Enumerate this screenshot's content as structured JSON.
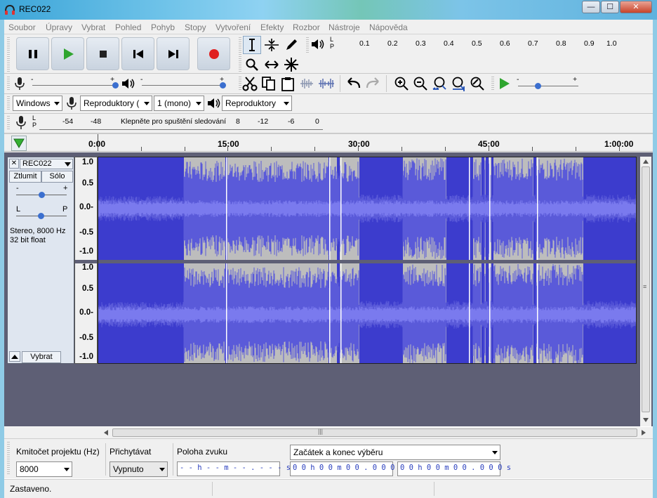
{
  "window": {
    "title": "REC022",
    "min": "—",
    "max": "☐",
    "close": "✕"
  },
  "menu": [
    "Soubor",
    "Úpravy",
    "Vybrat",
    "Pohled",
    "Pohyb",
    "Stopy",
    "Vytvoření",
    "Efekty",
    "Rozbor",
    "Nástroje",
    "Nápověda"
  ],
  "playback_meter": {
    "lp": "L\nP",
    "ticks": [
      "0.1",
      "0.2",
      "0.3",
      "0.4",
      "0.5",
      "0.6",
      "0.7",
      "0.8",
      "0.9",
      "1.0"
    ]
  },
  "devices": {
    "host": "Windows",
    "recording": "Reproduktory (",
    "channels": "1 (mono)",
    "playback": "Reproduktory"
  },
  "record_meter": {
    "lp": "L\nP",
    "ticks": [
      "-54",
      "-48"
    ],
    "hint": "Klepněte pro spuštění sledování",
    "ticks2": [
      "8",
      "-12",
      "-6",
      "0"
    ]
  },
  "timeline": {
    "labels": [
      "0:00",
      "15:00",
      "30:00",
      "45:00",
      "1:00:00"
    ]
  },
  "track": {
    "name": "REC022",
    "mute": "Ztlumit",
    "solo": "Sólo",
    "gain_minus": "-",
    "gain_plus": "+",
    "pan_l": "L",
    "pan_r": "P",
    "info1": "Stereo, 8000 Hz",
    "info2": "32 bit float",
    "select": "Vybrat",
    "close": "✕",
    "scale": [
      "1.0",
      "0.5",
      "0.0-",
      "-0.5",
      "-1.0"
    ],
    "selection_fill": "#3c3ccd",
    "wave_color": "#5a5ad9",
    "unselected_bg": "#bdbdbd"
  },
  "selection_toolbar": {
    "rate_label": "Kmitočet projektu (Hz)",
    "rate_value": "8000",
    "snap_label": "Přichytávat",
    "snap_value": "Vypnuto",
    "pos_label": "Poloha zvuku",
    "pos_value": "- - h - - m - - . - - - s",
    "mode_value": "Začátek a konec výběru",
    "start_value": "0 0 h 0 0 m 0 0 . 0 0 0 s",
    "end_value": "0 0 h 0 0 m 0 0 . 0 0 0 s"
  },
  "status": {
    "text": "Zastaveno."
  }
}
